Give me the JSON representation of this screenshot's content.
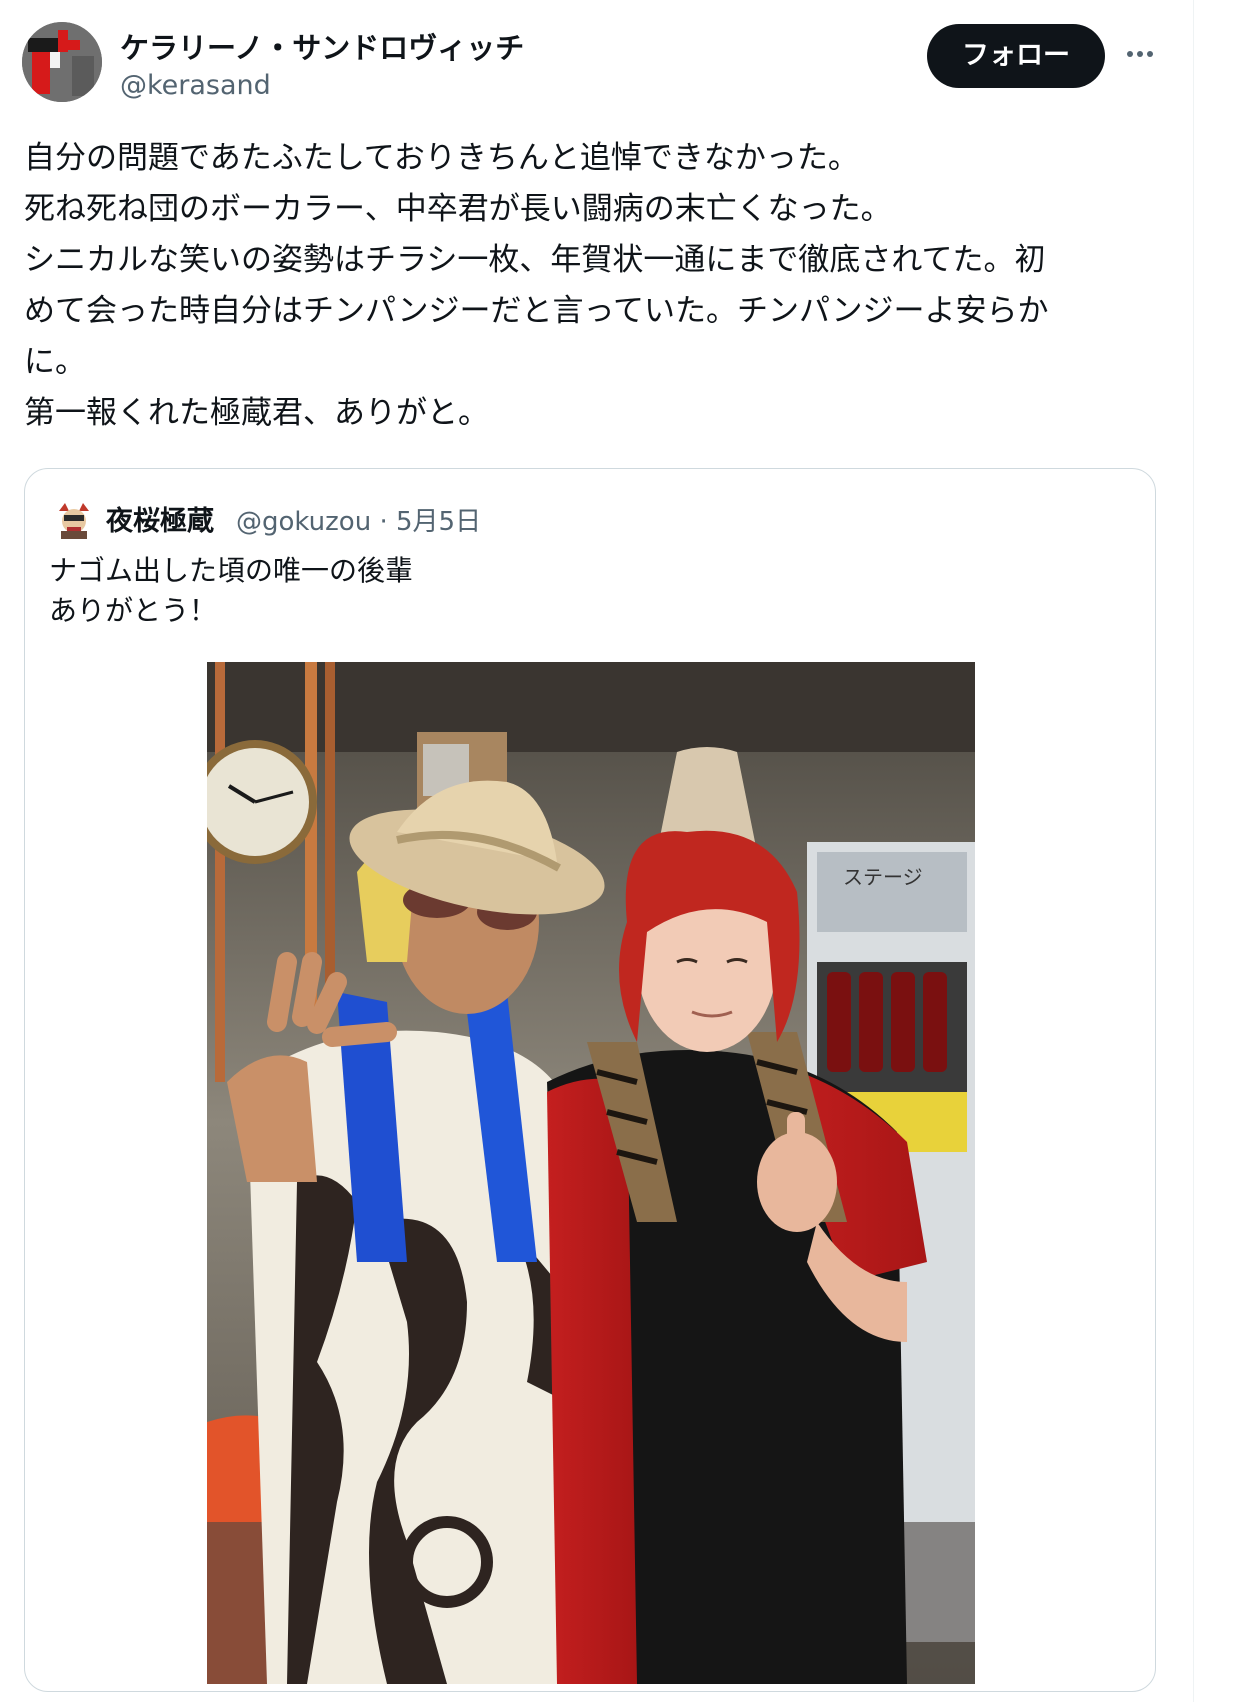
{
  "author": {
    "display_name": "ケラリーノ・サンドロヴィッチ",
    "handle": "@kerasand"
  },
  "actions": {
    "follow_label": "フォロー",
    "more_icon": "more-horizontal-icon"
  },
  "post": {
    "lines": [
      "自分の問題であたふたしておりきちんと追悼できなかった。",
      "死ね死ね団のボーカラー、中卒君が長い闘病の末亡くなった。",
      "シニカルな笑いの姿勢はチラシ一枚、年賀状一通にまで徹底されてた。初",
      "めて会った時自分はチンパンジーだと言っていた。チンパンジーよ安らか",
      "に。",
      "第一報くれた極蔵君、ありがと。"
    ]
  },
  "quoted_post": {
    "display_name": "夜桜極蔵",
    "handle": "@gokuzou",
    "separator": "·",
    "date": "5月5日",
    "lines": [
      "ナゴム出した頃の唯一の後輩",
      "ありがとう！"
    ]
  },
  "sign_text": "ステージ",
  "colors": {
    "follow_bg": "#0f1419",
    "text_primary": "#0f1419",
    "text_secondary": "#536471",
    "border": "#cfd9de"
  }
}
